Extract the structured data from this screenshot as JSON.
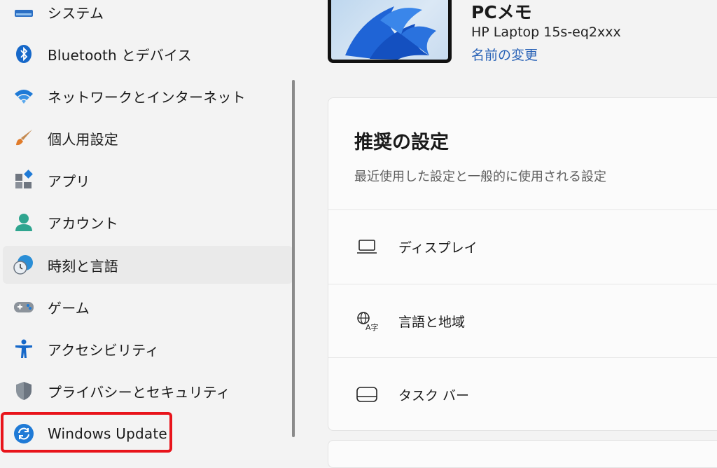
{
  "sidebar": {
    "items": [
      {
        "label": "システム",
        "icon": "system-icon"
      },
      {
        "label": "Bluetooth とデバイス",
        "icon": "bluetooth-icon"
      },
      {
        "label": "ネットワークとインターネット",
        "icon": "wifi-icon"
      },
      {
        "label": "個人用設定",
        "icon": "paintbrush-icon"
      },
      {
        "label": "アプリ",
        "icon": "apps-icon"
      },
      {
        "label": "アカウント",
        "icon": "account-icon"
      },
      {
        "label": "時刻と言語",
        "icon": "clock-globe-icon",
        "selected": true
      },
      {
        "label": "ゲーム",
        "icon": "gamepad-icon"
      },
      {
        "label": "アクセシビリティ",
        "icon": "accessibility-icon"
      },
      {
        "label": "プライバシーとセキュリティ",
        "icon": "shield-icon"
      },
      {
        "label": "Windows Update",
        "icon": "windows-update-icon",
        "highlighted": true
      }
    ]
  },
  "device": {
    "name": "PCメモ",
    "model": "HP Laptop 15s-eq2xxx",
    "rename_link": "名前の変更"
  },
  "recommended": {
    "title": "推奨の設定",
    "subtitle": "最近使用した設定と一般的に使用される設定",
    "items": [
      {
        "label": "ディスプレイ",
        "icon": "display-icon"
      },
      {
        "label": "言語と地域",
        "icon": "language-icon"
      },
      {
        "label": "タスク バー",
        "icon": "taskbar-icon"
      }
    ]
  },
  "colors": {
    "accent": "#0067c0",
    "highlight_box": "#e8141b",
    "link": "#2a63b7"
  }
}
